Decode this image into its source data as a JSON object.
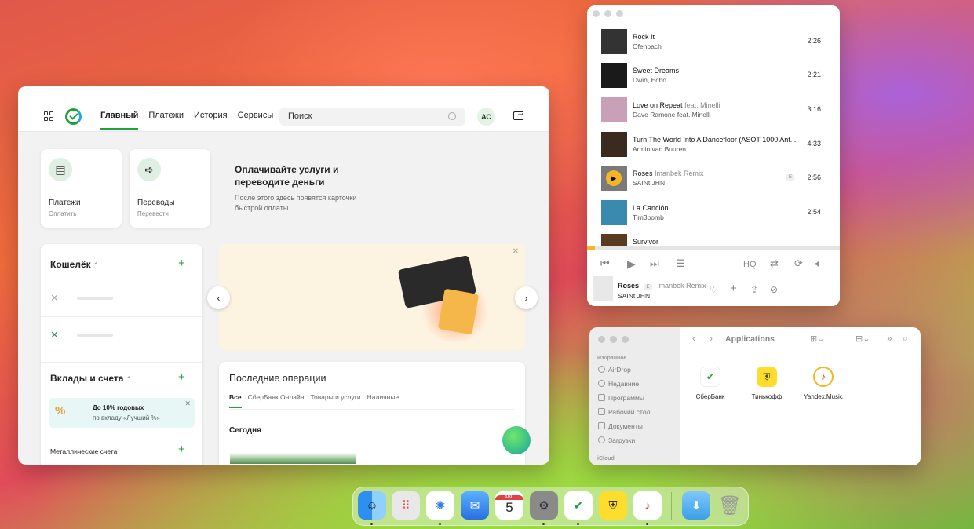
{
  "sber": {
    "nav": [
      "Главный",
      "Платежи",
      "История",
      "Сервисы"
    ],
    "search_placeholder": "Поиск",
    "avatar_initials": "АС",
    "quick": [
      {
        "title": "Платежи",
        "sub": "Оплатить"
      },
      {
        "title": "Переводы",
        "sub": "Перевести"
      }
    ],
    "promo_title": "Оплачивайте услуги и переводите деньги",
    "promo_sub": "После этого здесь появятся карточки быстрой оплаты",
    "wallet_title": "Кошелёк",
    "deposits_title": "Вклады и счета",
    "deposit_badge": {
      "line1": "До 10% годовых",
      "line2": "по вкладу «Лучший %»"
    },
    "metal_accounts": "Металлические счета",
    "operations_title": "Последние операции",
    "operations_tabs": [
      "Все",
      "СберБанк Онлайн",
      "Товары и услуги",
      "Наличные"
    ],
    "today": "Сегодня",
    "accent": "#21a038"
  },
  "music": {
    "tracks": [
      {
        "title": "Rock It",
        "feat": "",
        "artist": "Ofenbach",
        "duration": "2:26",
        "explicit": ""
      },
      {
        "title": "Sweet Dreams",
        "feat": "",
        "artist": "Dwin, Echo",
        "duration": "2:21",
        "explicit": ""
      },
      {
        "title": "Love on Repeat",
        "feat": "feat. Minelli",
        "artist": "Dave Ramone feat. Minelli",
        "duration": "3:16",
        "explicit": ""
      },
      {
        "title": "Turn The World Into A Dancefloor (ASOT 1000 Ant...",
        "feat": "",
        "artist": "Armin van Buuren",
        "duration": "4:33",
        "explicit": ""
      },
      {
        "title": "Roses",
        "feat": "Imanbek Remix",
        "artist": "SAINt JHN",
        "duration": "2:56",
        "explicit": "E"
      },
      {
        "title": "La Canción",
        "feat": "",
        "artist": "Tim3bomb",
        "duration": "2:54",
        "explicit": ""
      },
      {
        "title": "Survivor",
        "feat": "",
        "artist": "",
        "duration": "",
        "explicit": ""
      }
    ],
    "progress": 0.03,
    "quality_label": "HQ",
    "now_playing": {
      "title": "Roses",
      "explicit": "E",
      "feat": "Imanbek Remix",
      "artist": "SAINt JHN"
    },
    "accent": "#f4b625"
  },
  "finder": {
    "title": "Applications",
    "favorites_heading": "Избранное",
    "sidebar": [
      "AirDrop",
      "Недавние",
      "Программы",
      "Рабочий стол",
      "Документы",
      "Загрузки"
    ],
    "icloud_heading": "iCloud",
    "apps": [
      "СберБанк",
      "Тинькофф",
      "Yandex.Music"
    ]
  },
  "dock": {
    "calendar_month": "АВГ.",
    "calendar_day": "5"
  }
}
